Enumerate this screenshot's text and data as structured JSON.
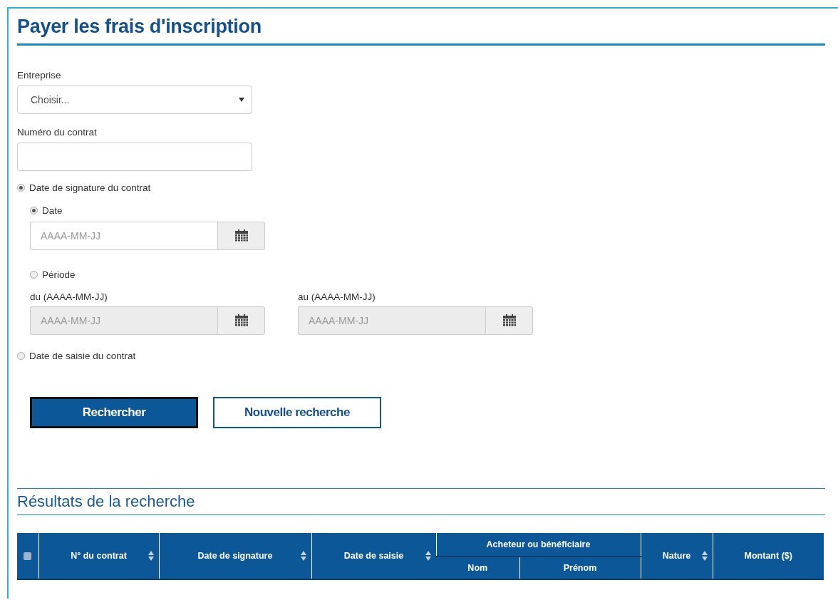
{
  "title": "Payer les frais d'inscription",
  "form": {
    "company": {
      "label": "Entreprise",
      "value": "Choisir..."
    },
    "contract_number": {
      "label": "Numéro du contrat"
    },
    "criteria": [
      {
        "label": "Date de signature du contrat",
        "selected": true,
        "kind": "signature"
      },
      {
        "label": "Date de saisie du contrat",
        "selected": false,
        "kind": "plain"
      }
    ],
    "date_modes": [
      {
        "label": "Date",
        "selected": true,
        "fields": [
          {
            "placeholder": "AAAA-MM-JJ",
            "disabled": false
          }
        ]
      },
      {
        "label": "Période",
        "selected": false,
        "fields": [
          {
            "label": "du (AAAA-MM-JJ)",
            "placeholder": "AAAA-MM-JJ",
            "disabled": true
          },
          {
            "label": "au (AAAA-MM-JJ)",
            "placeholder": "AAAA-MM-JJ",
            "disabled": true
          }
        ]
      }
    ]
  },
  "buttons": [
    {
      "label": "Rechercher",
      "kind": "primary"
    },
    {
      "label": "Nouvelle recherche",
      "kind": "secondary"
    }
  ],
  "results": {
    "title": "Résultats de la recherche",
    "select_all": {
      "checked": false
    },
    "columns": [
      {
        "label": "N° du contrat",
        "sortable": true
      },
      {
        "label": "Date de signature",
        "sortable": true
      },
      {
        "label": "Date de saisie",
        "sortable": true
      },
      {
        "label": "Acheteur ou bénéficiaire",
        "children": [
          {
            "label": "Nom"
          },
          {
            "label": "Prénom"
          }
        ]
      },
      {
        "label": "Nature",
        "sortable": true
      },
      {
        "label": "Montant ($)",
        "sortable": false
      }
    ]
  }
}
